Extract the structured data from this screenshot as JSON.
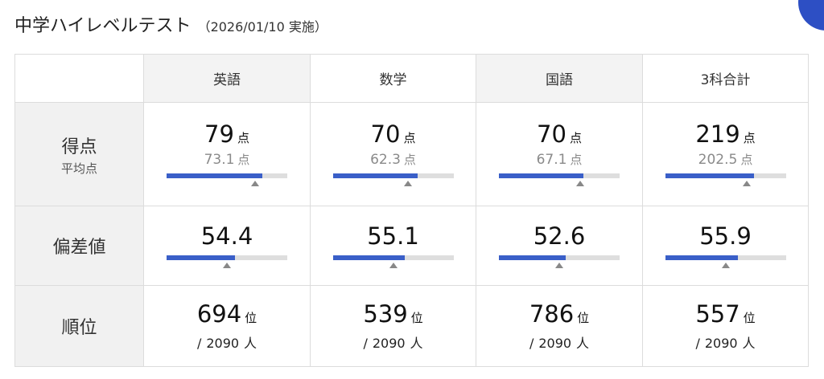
{
  "header": {
    "title": "中学ハイレベルテスト",
    "date": "（2026/01/10 実施）"
  },
  "row_labels": {
    "score": "得点",
    "average": "平均点",
    "deviation": "偏差値",
    "rank": "順位"
  },
  "units": {
    "point": "点",
    "rank": "位",
    "people": "人",
    "slash": "/"
  },
  "colors": {
    "bar_fill": "#3a5fc8",
    "bar_track": "#dedede",
    "marker": "#888888",
    "header_bg": "#f3f3f3",
    "label_bg": "#f1f1f1"
  },
  "subjects": [
    {
      "name": "英語",
      "score": "79",
      "average": "73.1",
      "score_ratio": 0.79,
      "average_ratio": 0.731,
      "deviation": "54.4",
      "deviation_ratio": 0.57,
      "deviation_marker": 0.5,
      "rank": "694",
      "total": "2090"
    },
    {
      "name": "数学",
      "score": "70",
      "average": "62.3",
      "score_ratio": 0.7,
      "average_ratio": 0.623,
      "deviation": "55.1",
      "deviation_ratio": 0.59,
      "deviation_marker": 0.5,
      "rank": "539",
      "total": "2090"
    },
    {
      "name": "国語",
      "score": "70",
      "average": "67.1",
      "score_ratio": 0.7,
      "average_ratio": 0.671,
      "deviation": "52.6",
      "deviation_ratio": 0.55,
      "deviation_marker": 0.5,
      "rank": "786",
      "total": "2090"
    },
    {
      "name": "3科合計",
      "score": "219",
      "average": "202.5",
      "score_ratio": 0.73,
      "average_ratio": 0.675,
      "deviation": "55.9",
      "deviation_ratio": 0.6,
      "deviation_marker": 0.5,
      "rank": "557",
      "total": "2090"
    }
  ]
}
